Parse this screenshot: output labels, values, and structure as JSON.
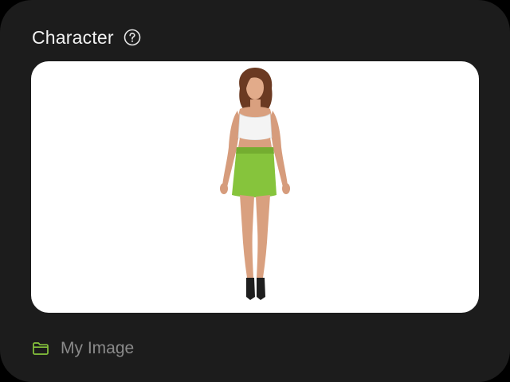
{
  "panel": {
    "title": "Character",
    "help_icon": "question-circle-icon"
  },
  "preview": {
    "subject": "character-image"
  },
  "footer": {
    "icon": "folder-icon",
    "label": "My Image",
    "accent_color": "#86c43c"
  },
  "colors": {
    "panel_bg": "#1c1c1c",
    "title_text": "#f2f2f2",
    "muted_text": "#8a8a8a",
    "image_bg": "#ffffff"
  }
}
